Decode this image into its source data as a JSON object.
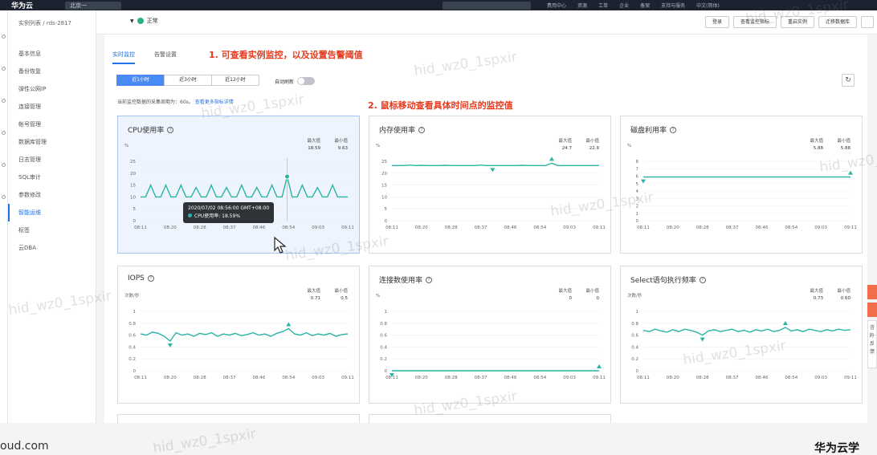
{
  "topbar": {
    "brand": "华为云",
    "region": "北京一",
    "links": [
      "费用中心",
      "资源",
      "工单",
      "企业",
      "备案",
      "支持与服务",
      "中文(简体)"
    ]
  },
  "breadcrumb": {
    "parent": "实例列表",
    "current": "rds-2817"
  },
  "instance": {
    "status": "正常"
  },
  "sidebar": {
    "items": [
      "基本信息",
      "备份恢复",
      "弹性公网IP",
      "连接管理",
      "帐号管理",
      "数据库管理",
      "日志管理",
      "SQL审计",
      "参数修改",
      "智能运维",
      "标签",
      "云DBA"
    ],
    "active_index": 9
  },
  "header_actions": [
    "登录",
    "查看监控指标",
    "重启实例",
    "迁移数据库"
  ],
  "tabs": {
    "items": [
      "实时监控",
      "告警设置"
    ],
    "active_index": 0
  },
  "ranges": {
    "items": [
      "近1小时",
      "近3小时",
      "近12小时"
    ],
    "active_index": 0
  },
  "auto_refresh_label": "自动刷新",
  "period_note": {
    "text": "当前监控数据的采集周期为：60s。",
    "link": "查看更多指标详情"
  },
  "annotations": {
    "a1": "1. 可查看实例监控，以及设置告警阈值",
    "a2": "2. 鼠标移动查看具体时间点的监控值"
  },
  "tooltip": {
    "time": "2020/07/02 08:56:00 GMT+08:00",
    "metric": "CPU使用率",
    "value": "18.59%"
  },
  "watermark": "hid_wz0_1spxir",
  "footer": {
    "left": "oud.com",
    "right": "华为云学"
  },
  "side_float": {
    "text": "咨询·反馈"
  },
  "chart_data": [
    {
      "name": "CPU使用率",
      "type": "line",
      "unit": "%",
      "max_label": "最大值",
      "min_label": "最小值",
      "max": "18.59",
      "min": "9.63",
      "yticks": [
        "25",
        "20",
        "15",
        "10",
        "5",
        "0"
      ],
      "ylim": [
        0,
        25
      ],
      "xticks": [
        "08:11",
        "08:20",
        "08:28",
        "08:37",
        "08:46",
        "08:54",
        "09:03",
        "09:11"
      ],
      "values": [
        10,
        10,
        15,
        10,
        10,
        15,
        10,
        10,
        15,
        10,
        10,
        14,
        10,
        10,
        15,
        10,
        10,
        14,
        10,
        10,
        15,
        10,
        10,
        14,
        10,
        10,
        15,
        10,
        10,
        18.59,
        10,
        10,
        15,
        10,
        10,
        14,
        10,
        10,
        15,
        10,
        10,
        10
      ],
      "highlight_index": 29
    },
    {
      "name": "内存使用率",
      "type": "line",
      "unit": "%",
      "max_label": "最大值",
      "min_label": "最小值",
      "max": "24.7",
      "min": "22.9",
      "yticks": [
        "25",
        "20",
        "15",
        "10",
        "5",
        "0"
      ],
      "ylim": [
        0,
        25
      ],
      "xticks": [
        "08:11",
        "08:20",
        "08:28",
        "08:37",
        "08:46",
        "08:54",
        "09:03",
        "09:11"
      ],
      "values": [
        23.2,
        23.2,
        23.2,
        23.4,
        23.2,
        23.3,
        23.2,
        23.2,
        23.2,
        23.3,
        23.2,
        23.2,
        23.2,
        23.2,
        23.2,
        23.4,
        23.2,
        23.2,
        23.2,
        23.2,
        23.2,
        23.2,
        23.3,
        23.2,
        23.2,
        23.2,
        23.2,
        24.2,
        23.2,
        23.2,
        23.2,
        23.2,
        23.2,
        23.2,
        23.2,
        23.2
      ],
      "max_index": 27,
      "min_index": 17
    },
    {
      "name": "磁盘利用率",
      "type": "line",
      "unit": "%",
      "max_label": "最大值",
      "min_label": "最小值",
      "max": "5.88",
      "min": "5.88",
      "yticks": [
        "8",
        "7",
        "6",
        "5",
        "4",
        "3",
        "2",
        "1",
        "0"
      ],
      "ylim": [
        0,
        8
      ],
      "xticks": [
        "08:11",
        "08:20",
        "08:28",
        "08:37",
        "08:46",
        "08:54",
        "09:03",
        "09:11"
      ],
      "values": [
        5.88,
        5.88,
        5.88,
        5.88,
        5.88,
        5.88,
        5.88,
        5.88,
        5.88,
        5.88,
        5.88,
        5.88,
        5.88,
        5.88,
        5.88,
        5.88,
        5.88,
        5.88,
        5.88,
        5.88
      ],
      "max_index": 19,
      "min_index": 0
    },
    {
      "name": "IOPS",
      "type": "line",
      "unit": "次数/秒",
      "max_label": "最大值",
      "min_label": "最小值",
      "max": "0.71",
      "min": "0.5",
      "yticks": [
        "1",
        "0.8",
        "0.6",
        "0.4",
        "0.2",
        "0"
      ],
      "ylim": [
        0,
        1
      ],
      "xticks": [
        "08:11",
        "08:20",
        "08:28",
        "08:37",
        "08:46",
        "08:54",
        "09:03",
        "09:11"
      ],
      "values": [
        0.62,
        0.6,
        0.65,
        0.63,
        0.58,
        0.5,
        0.64,
        0.6,
        0.62,
        0.58,
        0.63,
        0.61,
        0.64,
        0.58,
        0.62,
        0.6,
        0.63,
        0.59,
        0.61,
        0.64,
        0.6,
        0.62,
        0.58,
        0.63,
        0.66,
        0.71,
        0.62,
        0.6,
        0.64,
        0.59,
        0.62,
        0.6,
        0.63,
        0.58,
        0.61,
        0.62
      ],
      "max_index": 25,
      "min_index": 5
    },
    {
      "name": "连接数使用率",
      "type": "line",
      "unit": "%",
      "max_label": "最大值",
      "min_label": "最小值",
      "max": "0",
      "min": "0",
      "yticks": [
        "1",
        "0.8",
        "0.6",
        "0.4",
        "0.2",
        "0"
      ],
      "ylim": [
        0,
        1
      ],
      "xticks": [
        "08:11",
        "08:20",
        "08:28",
        "08:37",
        "08:46",
        "08:54",
        "09:03",
        "09:11"
      ],
      "values": [
        0,
        0,
        0,
        0,
        0,
        0,
        0,
        0,
        0,
        0,
        0,
        0,
        0,
        0,
        0,
        0,
        0,
        0,
        0,
        0
      ],
      "max_index": 19,
      "min_index": 0
    },
    {
      "name": "Select语句执行频率",
      "type": "line",
      "unit": "次数/秒",
      "max_label": "最大值",
      "min_label": "最小值",
      "max": "0.73",
      "min": "0.60",
      "yticks": [
        "1",
        "0.8",
        "0.6",
        "0.4",
        "0.2",
        "0"
      ],
      "ylim": [
        0,
        1
      ],
      "xticks": [
        "08:11",
        "08:20",
        "08:28",
        "08:37",
        "08:46",
        "08:54",
        "09:03",
        "09:11"
      ],
      "values": [
        0.68,
        0.66,
        0.7,
        0.67,
        0.65,
        0.69,
        0.66,
        0.7,
        0.68,
        0.65,
        0.6,
        0.67,
        0.69,
        0.66,
        0.68,
        0.7,
        0.66,
        0.68,
        0.65,
        0.69,
        0.67,
        0.7,
        0.66,
        0.68,
        0.73,
        0.67,
        0.69,
        0.66,
        0.7,
        0.68,
        0.66,
        0.69,
        0.67,
        0.7,
        0.68,
        0.69
      ],
      "max_index": 24,
      "min_index": 10
    }
  ]
}
